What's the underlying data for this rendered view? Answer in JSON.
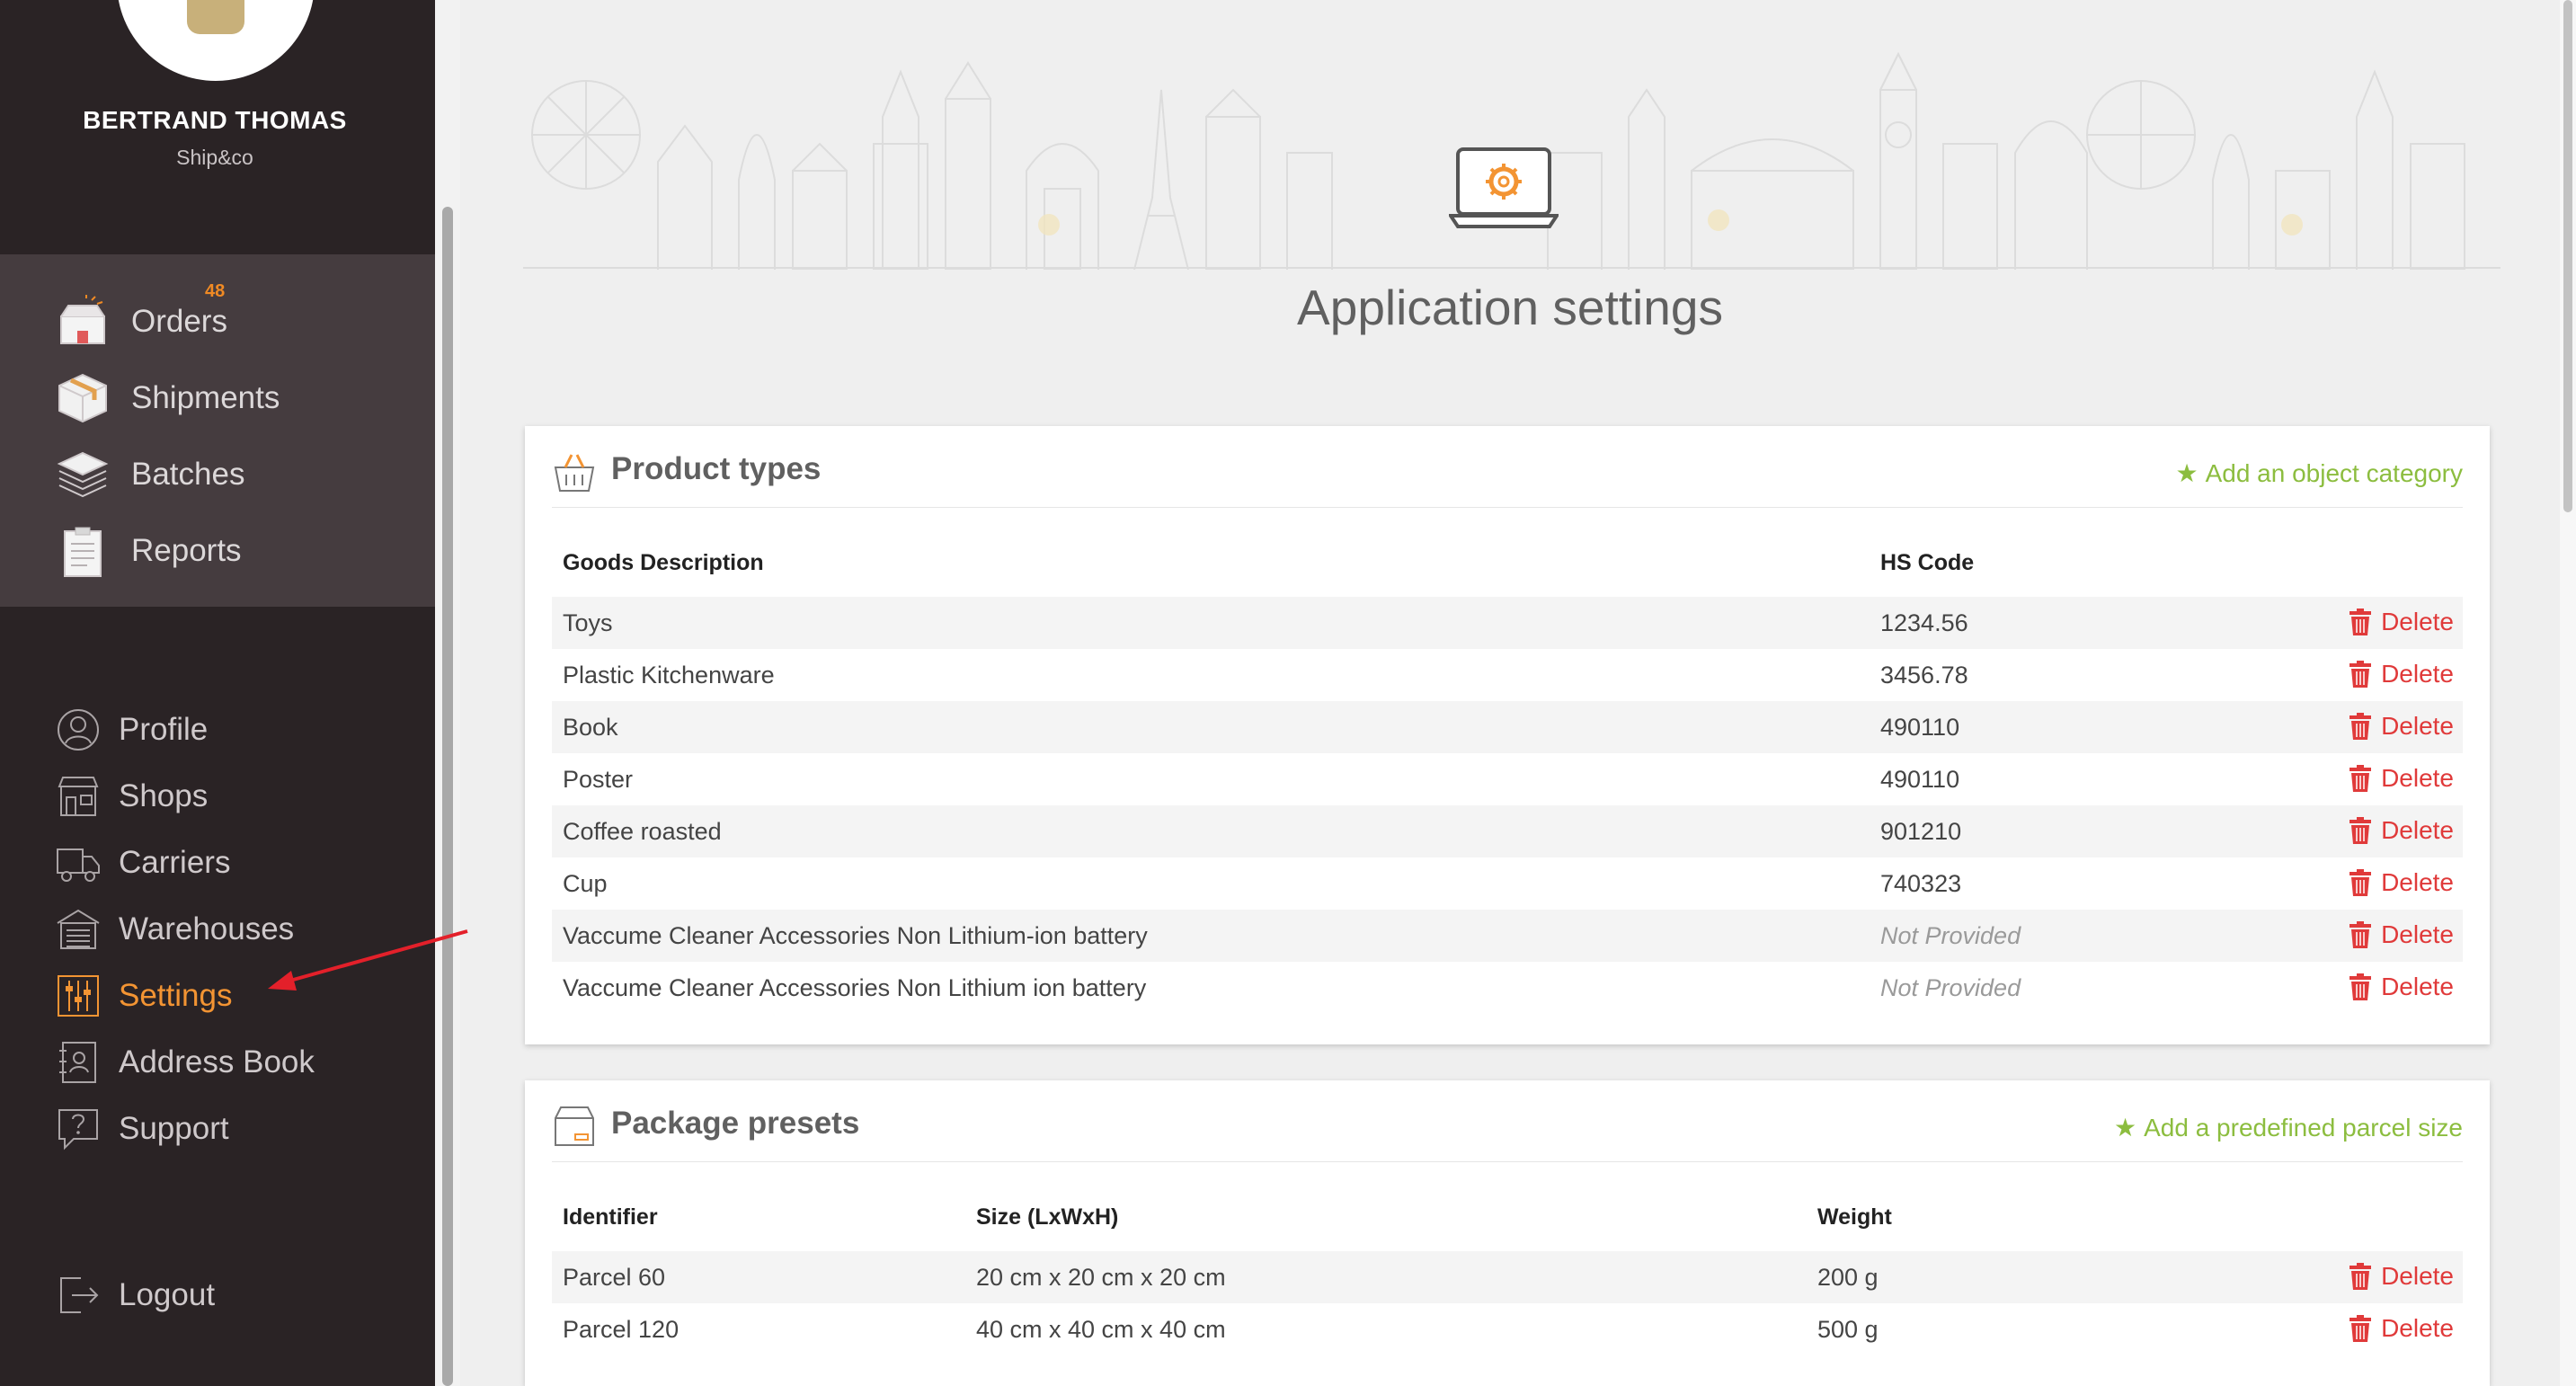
{
  "user": {
    "name": "BERTRAND THOMAS",
    "company": "Ship&co"
  },
  "main_nav": [
    {
      "label": "Orders",
      "icon": "orders-box-icon",
      "badge": "48"
    },
    {
      "label": "Shipments",
      "icon": "package-icon"
    },
    {
      "label": "Batches",
      "icon": "stack-icon"
    },
    {
      "label": "Reports",
      "icon": "clipboard-icon"
    }
  ],
  "secondary_nav": [
    {
      "label": "Profile",
      "icon": "user-circle-icon"
    },
    {
      "label": "Shops",
      "icon": "shop-icon"
    },
    {
      "label": "Carriers",
      "icon": "truck-icon"
    },
    {
      "label": "Warehouses",
      "icon": "warehouse-icon"
    },
    {
      "label": "Settings",
      "icon": "sliders-icon",
      "active": true
    },
    {
      "label": "Address Book",
      "icon": "address-book-icon"
    },
    {
      "label": "Support",
      "icon": "question-bubble-icon"
    }
  ],
  "logout": {
    "label": "Logout",
    "icon": "logout-icon"
  },
  "page": {
    "title": "Application settings"
  },
  "product_types": {
    "title": "Product types",
    "action": "Add an object category",
    "headers": {
      "description": "Goods Description",
      "hs_code": "HS Code"
    },
    "rows": [
      {
        "description": "Toys",
        "hs_code": "1234.56"
      },
      {
        "description": "Plastic Kitchenware",
        "hs_code": "3456.78"
      },
      {
        "description": "Book",
        "hs_code": "490110"
      },
      {
        "description": "Poster",
        "hs_code": "490110"
      },
      {
        "description": "Coffee roasted",
        "hs_code": "901210"
      },
      {
        "description": "Cup",
        "hs_code": "740323"
      },
      {
        "description": "Vaccume Cleaner Accessories Non Lithium-ion battery",
        "hs_code": "Not Provided"
      },
      {
        "description": "Vaccume Cleaner Accessories Non Lithium ion battery",
        "hs_code": "Not Provided"
      }
    ],
    "delete_label": "Delete"
  },
  "package_presets": {
    "title": "Package presets",
    "action": "Add a predefined parcel size",
    "headers": {
      "identifier": "Identifier",
      "size": "Size (LxWxH)",
      "weight": "Weight"
    },
    "rows": [
      {
        "identifier": "Parcel 60",
        "size": "20 cm x 20 cm x 20 cm",
        "weight": "200 g"
      },
      {
        "identifier": "Parcel 120",
        "size": "40 cm x 40 cm x 40 cm",
        "weight": "500 g"
      }
    ],
    "delete_label": "Delete"
  },
  "colors": {
    "accent": "#f39433",
    "sidebar_bg": "#2a2325",
    "green": "#8cbd3f",
    "danger": "#e03a3a"
  }
}
